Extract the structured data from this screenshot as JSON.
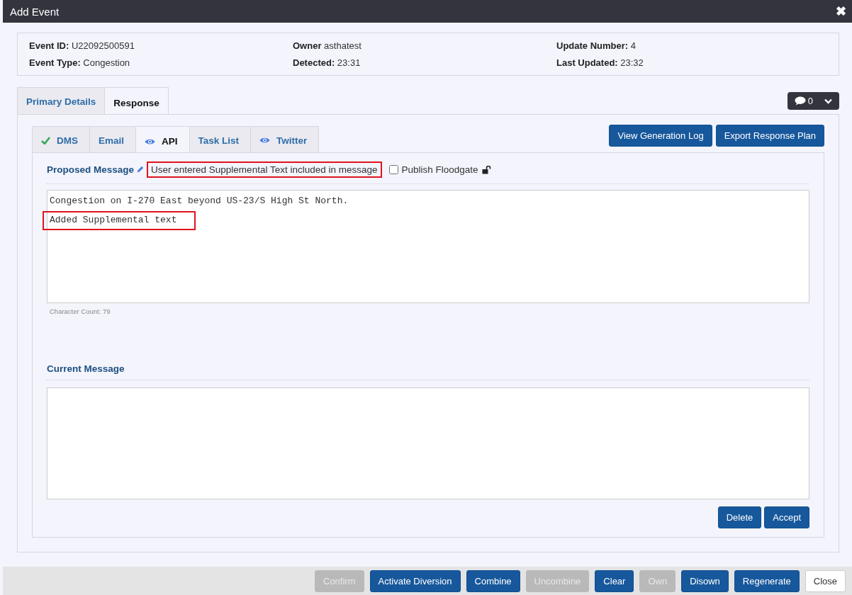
{
  "window": {
    "title": "Add Event",
    "close": "✖"
  },
  "info": [
    {
      "label": "Event ID:",
      "value": "U22092500591"
    },
    {
      "label": "Owner",
      "value": "asthatest"
    },
    {
      "label": "Update Number:",
      "value": "4"
    },
    {
      "label": "Event Type:",
      "value": "Congestion"
    },
    {
      "label": "Detected:",
      "value": "23:31"
    },
    {
      "label": "Last Updated:",
      "value": "23:32"
    }
  ],
  "tabs": [
    {
      "label": "Primary Details",
      "selected": false
    },
    {
      "label": "Response",
      "selected": true
    }
  ],
  "comments": {
    "count": "0"
  },
  "subtabs": [
    {
      "label": "DMS",
      "kind": "check",
      "selected": false
    },
    {
      "label": "Email",
      "kind": "plain",
      "selected": false
    },
    {
      "label": "API",
      "kind": "eye",
      "selected": true
    },
    {
      "label": "Task List",
      "kind": "plain",
      "selected": false
    },
    {
      "label": "Twitter",
      "kind": "eye",
      "selected": false
    }
  ],
  "top_buttons": [
    "View Generation Log",
    "Export Response Plan"
  ],
  "proposed": {
    "title": "Proposed Message",
    "note": "User entered Supplemental Text included in message",
    "note_highlighted": true,
    "publish_label": "Publish Floodgate",
    "publish_checked": false,
    "lines": [
      {
        "text": "Congestion on I-270 East beyond US-23/S High St North.",
        "highlighted": false
      },
      {
        "text": "Added Supplemental text",
        "highlighted": true
      }
    ],
    "char_count": "Character Count: 79"
  },
  "current": {
    "title": "Current Message"
  },
  "message_buttons": [
    "Delete",
    "Accept"
  ],
  "footer_buttons": [
    {
      "label": "Confirm",
      "kind": "primary",
      "disabled": true
    },
    {
      "label": "Activate Diversion",
      "kind": "primary",
      "disabled": false
    },
    {
      "label": "Combine",
      "kind": "primary",
      "disabled": false
    },
    {
      "label": "Uncombine",
      "kind": "primary",
      "disabled": true
    },
    {
      "label": "Clear",
      "kind": "primary",
      "disabled": false
    },
    {
      "label": "Own",
      "kind": "primary",
      "disabled": true
    },
    {
      "label": "Disown",
      "kind": "primary",
      "disabled": false
    },
    {
      "label": "Regenerate",
      "kind": "primary",
      "disabled": false
    },
    {
      "label": "Close",
      "kind": "plain",
      "disabled": false
    }
  ]
}
